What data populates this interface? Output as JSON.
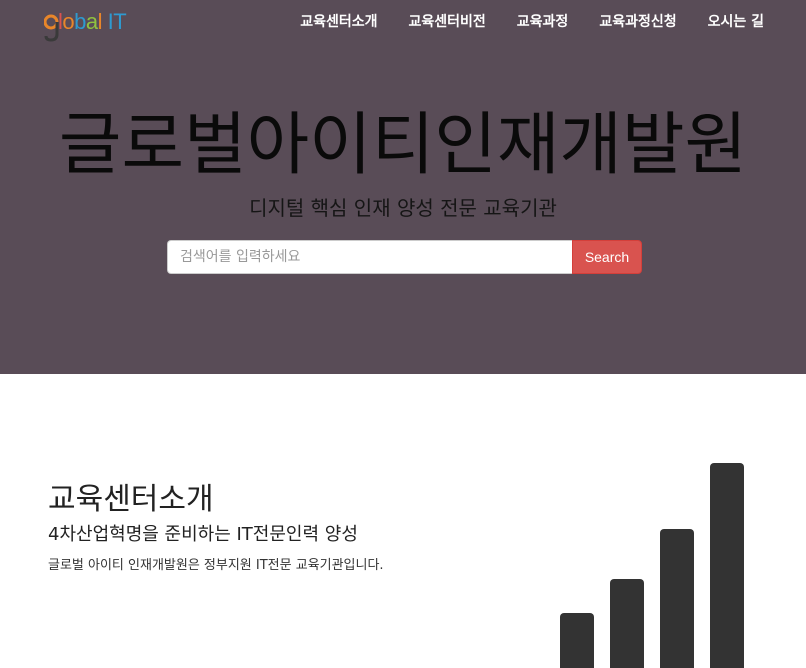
{
  "navbar": {
    "logo": {
      "letter_g": "G",
      "text_lobal": "lobal",
      "text_it": " IT",
      "colors": {
        "g_orange": "#e8862a",
        "g_dark": "#3a3a3a",
        "l": "#d9534f",
        "o": "#e8862a",
        "b": "#2e9ad0",
        "a": "#8fc23f",
        "l2": "#e8862a",
        "it": "#2e9ad0"
      }
    },
    "links": [
      {
        "label": "교육센터소개"
      },
      {
        "label": "교육센터비전"
      },
      {
        "label": "교육과정"
      },
      {
        "label": "교육과정신청"
      },
      {
        "label": "오시는 길"
      }
    ]
  },
  "hero": {
    "title": "글로벌아이티인재개발원",
    "subtitle": "디지털 핵심 인재 양성 전문 교육기관",
    "background_color": "#594c57",
    "search": {
      "placeholder": "검색어를 입력하세요",
      "value": "",
      "button_label": "Search",
      "button_color": "#d9534f"
    }
  },
  "intro": {
    "title": "교육센터소개",
    "subtitle": "4차산업혁명을 준비하는 IT전문인력 양성",
    "text": "글로벌 아이티 인재개발원은 정부지원 IT전문 교육기관입니다.",
    "icon": "bar-chart-icon",
    "icon_color": "#333333"
  }
}
